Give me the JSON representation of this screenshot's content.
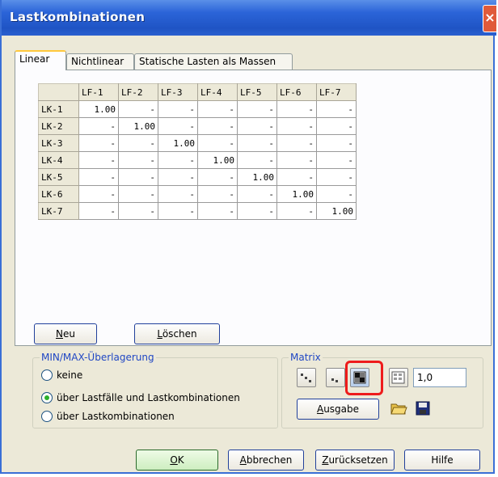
{
  "window": {
    "title": "Lastkombinationen",
    "close_glyph": "×"
  },
  "tabs": [
    {
      "label": "Linear",
      "active": true
    },
    {
      "label": "Nichtlinear",
      "active": false
    },
    {
      "label": "Statische Lasten als Massen",
      "active": false
    }
  ],
  "matrix": {
    "columns": [
      "LF-1",
      "LF-2",
      "LF-3",
      "LF-4",
      "LF-5",
      "LF-6",
      "LF-7"
    ],
    "rows": [
      {
        "label": "LK-1",
        "cells": [
          "1.00",
          "-",
          "-",
          "-",
          "-",
          "-",
          "-"
        ]
      },
      {
        "label": "LK-2",
        "cells": [
          "-",
          "1.00",
          "-",
          "-",
          "-",
          "-",
          "-"
        ]
      },
      {
        "label": "LK-3",
        "cells": [
          "-",
          "-",
          "1.00",
          "-",
          "-",
          "-",
          "-"
        ]
      },
      {
        "label": "LK-4",
        "cells": [
          "-",
          "-",
          "-",
          "1.00",
          "-",
          "-",
          "-"
        ]
      },
      {
        "label": "LK-5",
        "cells": [
          "-",
          "-",
          "-",
          "-",
          "1.00",
          "-",
          "-"
        ]
      },
      {
        "label": "LK-6",
        "cells": [
          "-",
          "-",
          "-",
          "-",
          "-",
          "1.00",
          "-"
        ]
      },
      {
        "label": "LK-7",
        "cells": [
          "-",
          "-",
          "-",
          "-",
          "-",
          "-",
          "1.00"
        ]
      }
    ]
  },
  "buttons": {
    "neu": {
      "accel": "N",
      "rest": "eu"
    },
    "loeschen": {
      "accel": "L",
      "rest": "öschen"
    }
  },
  "minmax": {
    "legend": "MIN/MAX-Überlagerung",
    "options": [
      {
        "label": "keine",
        "checked": false
      },
      {
        "label": "über Lastfälle und Lastkombinationen",
        "checked": true
      },
      {
        "label": "über Lastkombinationen",
        "checked": false
      }
    ]
  },
  "matrix_group": {
    "legend": "Matrix",
    "factor_value": "1,0",
    "ausgabe": {
      "accel": "A",
      "rest": "usgabe"
    },
    "icons": [
      "lower-triangle-icon",
      "upper-triangle-icon",
      "diagonal-matrix-icon",
      "fill-matrix-icon",
      "open-folder-icon",
      "save-disk-icon"
    ],
    "highlight_color": "#ee1c1c"
  },
  "footer": {
    "ok": {
      "accel": "O",
      "rest": "K"
    },
    "abbrechen": {
      "accel": "A",
      "rest": "bbrechen"
    },
    "zuruecksetzen": {
      "accel": "Z",
      "rest": "urücksetzen"
    },
    "hilfe": {
      "label": "Hilfe"
    }
  },
  "colors": {
    "titlebar": "#2b64d8",
    "dialog": "#ece9d8",
    "group_label": "#2047c4",
    "tab_highlight": "#ffc83c"
  }
}
